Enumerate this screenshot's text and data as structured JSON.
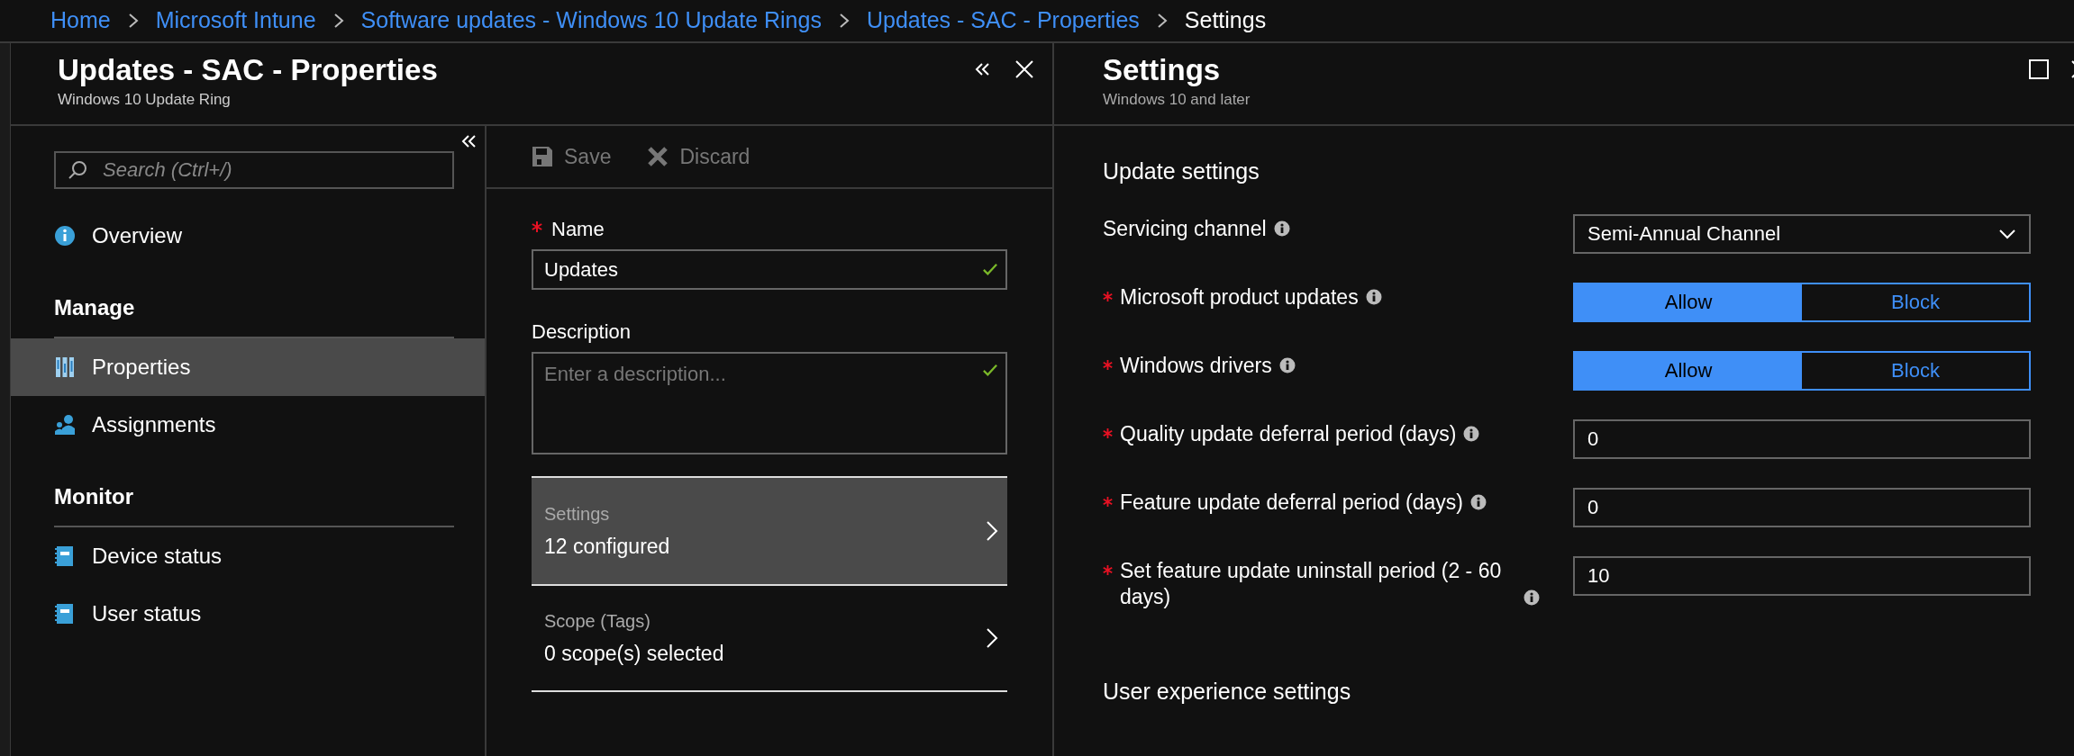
{
  "breadcrumb": [
    {
      "label": "Home",
      "current": false
    },
    {
      "label": "Microsoft Intune",
      "current": false
    },
    {
      "label": "Software updates - Windows 10 Update Rings",
      "current": false
    },
    {
      "label": "Updates - SAC - Properties",
      "current": false
    },
    {
      "label": "Settings",
      "current": true
    }
  ],
  "left_blade": {
    "title": "Updates - SAC - Properties",
    "subtitle": "Windows 10 Update Ring",
    "search": {
      "placeholder": "Search (Ctrl+/)"
    },
    "nav": [
      {
        "kind": "item",
        "label": "Overview",
        "selected": false
      },
      {
        "kind": "heading",
        "label": "Manage"
      },
      {
        "kind": "item",
        "label": "Properties",
        "selected": true
      },
      {
        "kind": "item",
        "label": "Assignments",
        "selected": false
      },
      {
        "kind": "heading",
        "label": "Monitor"
      },
      {
        "kind": "item",
        "label": "Device status",
        "selected": false
      },
      {
        "kind": "item",
        "label": "User status",
        "selected": false
      }
    ],
    "toolbar": [
      {
        "label": "Save",
        "disabled": true
      },
      {
        "label": "Discard",
        "disabled": true
      }
    ],
    "form": {
      "name": {
        "label": "Name",
        "required": true,
        "value": "Updates",
        "valid": true
      },
      "description": {
        "label": "Description",
        "required": false,
        "placeholder": "Enter a description...",
        "valid": true
      }
    },
    "links": [
      {
        "label": "Settings",
        "value": "12 configured",
        "selected": true
      },
      {
        "label": "Scope (Tags)",
        "value": "0 scope(s) selected",
        "selected": false
      }
    ]
  },
  "right_blade": {
    "title": "Settings",
    "subtitle": "Windows 10 and later",
    "sections": [
      {
        "heading": "Update settings",
        "rows": [
          {
            "kind": "dropdown",
            "label": "Servicing channel",
            "required": false,
            "value": "Semi-Annual Channel"
          },
          {
            "kind": "toggle",
            "label": "Microsoft product updates",
            "required": true,
            "options": [
              {
                "label": "Allow",
                "selected": true
              },
              {
                "label": "Block",
                "selected": false
              }
            ]
          },
          {
            "kind": "toggle",
            "label": "Windows drivers",
            "required": true,
            "options": [
              {
                "label": "Allow",
                "selected": true
              },
              {
                "label": "Block",
                "selected": false
              }
            ]
          },
          {
            "kind": "text",
            "label": "Quality update deferral period (days)",
            "required": true,
            "value": "0"
          },
          {
            "kind": "text",
            "label": "Feature update deferral period (days)",
            "required": true,
            "value": "0"
          },
          {
            "kind": "text",
            "label": "Set feature update uninstall period (2 - 60 days)",
            "required": true,
            "value": "10"
          }
        ]
      },
      {
        "heading": "User experience settings"
      }
    ]
  }
}
